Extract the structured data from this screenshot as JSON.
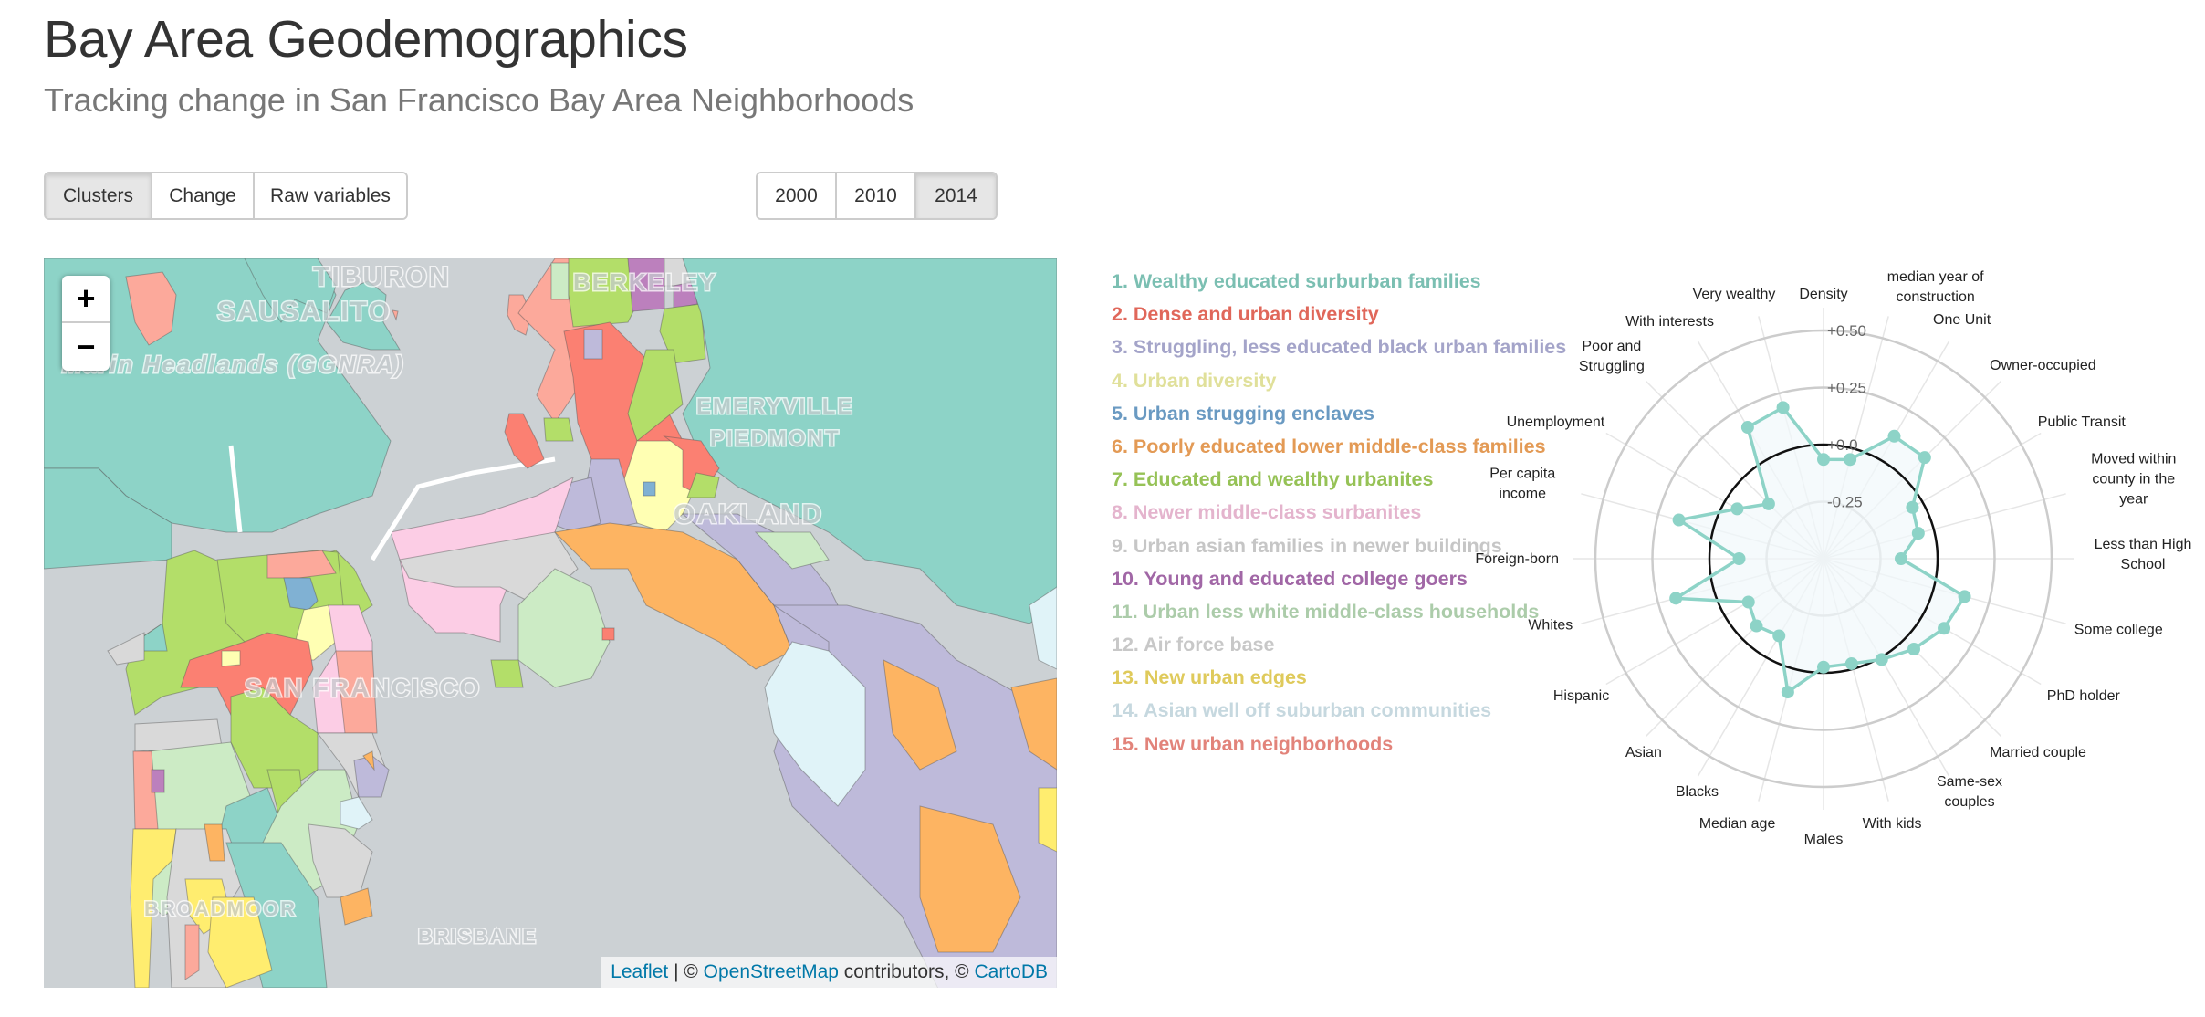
{
  "header": {
    "title": "Bay Area Geodemographics",
    "subtitle": "Tracking change in San Francisco Bay Area Neighborhoods"
  },
  "mode_buttons": [
    {
      "label": "Clusters",
      "active": true
    },
    {
      "label": "Change",
      "active": false
    },
    {
      "label": "Raw variables",
      "active": false
    }
  ],
  "year_buttons": [
    {
      "label": "2000",
      "active": false
    },
    {
      "label": "2010",
      "active": false
    },
    {
      "label": "2014",
      "active": true
    }
  ],
  "map": {
    "zoom_in_label": "+",
    "zoom_out_label": "−",
    "place_labels": [
      "TIBURON",
      "SAUSALITO",
      "Marin Headlands (GGNRA)",
      "EMERYVILLE",
      "BERKELEY",
      "PIEDMONT",
      "OAKLAND",
      "SAN FRANCISCO",
      "BRISBANE",
      "BROADMOOR"
    ],
    "attribution": {
      "leaflet": "Leaflet",
      "sep": " | © ",
      "osm": "OpenStreetMap",
      "contributors": " contributors, © ",
      "carto": "CartoDB"
    }
  },
  "legend": {
    "items": [
      {
        "label": "1. Wealthy educated surburban families",
        "color": "#7bbfb2"
      },
      {
        "label": "2. Dense and urban diversity",
        "color": "#e0675a"
      },
      {
        "label": "3. Struggling, less educated black urban families",
        "color": "#a4a4c9"
      },
      {
        "label": "4. Urban diversity",
        "color": "#e0e09a"
      },
      {
        "label": "5. Urban strugging enclaves",
        "color": "#6a9ac2"
      },
      {
        "label": "6. Poorly educated lower middle-class families",
        "color": "#e39a55"
      },
      {
        "label": "7. Educated and wealthy urbanites",
        "color": "#96c256"
      },
      {
        "label": "8. Newer middle-class surbanites",
        "color": "#e4b4cd"
      },
      {
        "label": "9. Urban asian families in newer buildings",
        "color": "#c6c6c6"
      },
      {
        "label": "10. Young and educated college goers",
        "color": "#a167a6"
      },
      {
        "label": "11. Urban less white middle-class households",
        "color": "#acccaa"
      },
      {
        "label": "12. Air force base",
        "color": "#c8c8c8"
      },
      {
        "label": "13. New urban edges",
        "color": "#dfca5b"
      },
      {
        "label": "14. Asian well off suburban communities",
        "color": "#c6d8df"
      },
      {
        "label": "15. New urban neighborhoods",
        "color": "#e2837a"
      }
    ]
  },
  "map_fill_colors": {
    "1": "#8dd3c7",
    "2": "#fb8072",
    "3": "#bebada",
    "4": "#ffffb3",
    "5": "#80b1d3",
    "6": "#fdb462",
    "7": "#b3de69",
    "8": "#fccde5",
    "9": "#d9d9d9",
    "10": "#bc80bd",
    "11": "#ccebc5",
    "12": "#d9d9d9",
    "13": "#ffed6f",
    "14": "#e0f3f8",
    "15": "#fca99b"
  },
  "chart_data": {
    "type": "radar",
    "title": "",
    "series": [
      {
        "name": "1. Wealthy educated surburban families",
        "color": "#8dd3c7",
        "values": [
          -0.065,
          -0.05,
          0.12,
          0.127,
          -0.05,
          -0.07,
          -0.16,
          0.14,
          0.11,
          0.06,
          0.01,
          -0.024,
          -0.025,
          0.105,
          -0.11,
          -0.084,
          -0.12,
          0.17,
          -0.13,
          0.156,
          -0.063,
          -0.16,
          0.165,
          0.186
        ]
      }
    ],
    "axes": [
      "Density",
      "median year of construction",
      "One Unit",
      "Owner-occupied",
      "Public Transit",
      "Moved within county in the year",
      "Less than High School",
      "Some college",
      "PhD holder",
      "Married couple",
      "Same-sex couples",
      "With kids",
      "Males",
      "Median age",
      "Blacks",
      "Asian",
      "Hispanic",
      "Whites",
      "Foreign-born",
      "Per capita income",
      "Unemployment",
      "Poor and Struggling",
      "With interests",
      "Very wealthy"
    ],
    "axis_label_lines": [
      [
        "Density"
      ],
      [
        "median year of",
        "construction"
      ],
      [
        "One Unit"
      ],
      [
        "Owner-occupied"
      ],
      [
        "Public Transit"
      ],
      [
        "Moved within",
        "county in the",
        "year"
      ],
      [
        "Less than High",
        "School"
      ],
      [
        "Some college"
      ],
      [
        "PhD holder"
      ],
      [
        "Married couple"
      ],
      [
        "Same-sex",
        "couples"
      ],
      [
        "With kids"
      ],
      [
        "Males"
      ],
      [
        "Median age"
      ],
      [
        "Blacks"
      ],
      [
        "Asian"
      ],
      [
        "Hispanic"
      ],
      [
        "Whites"
      ],
      [
        "Foreign-born"
      ],
      [
        "Per capita",
        "income"
      ],
      [
        "Unemployment"
      ],
      [
        "Poor and",
        "Struggling"
      ],
      [
        "With interests"
      ],
      [
        "Very wealthy"
      ]
    ],
    "range": [
      -0.5,
      0.5
    ],
    "gridlines": [
      -0.25,
      0.0,
      0.25,
      0.5
    ],
    "tick_labels": [
      "-0.25",
      "+0.0",
      "+0.25",
      "+0.50"
    ],
    "reference_circle": 0.0,
    "grid": true
  }
}
